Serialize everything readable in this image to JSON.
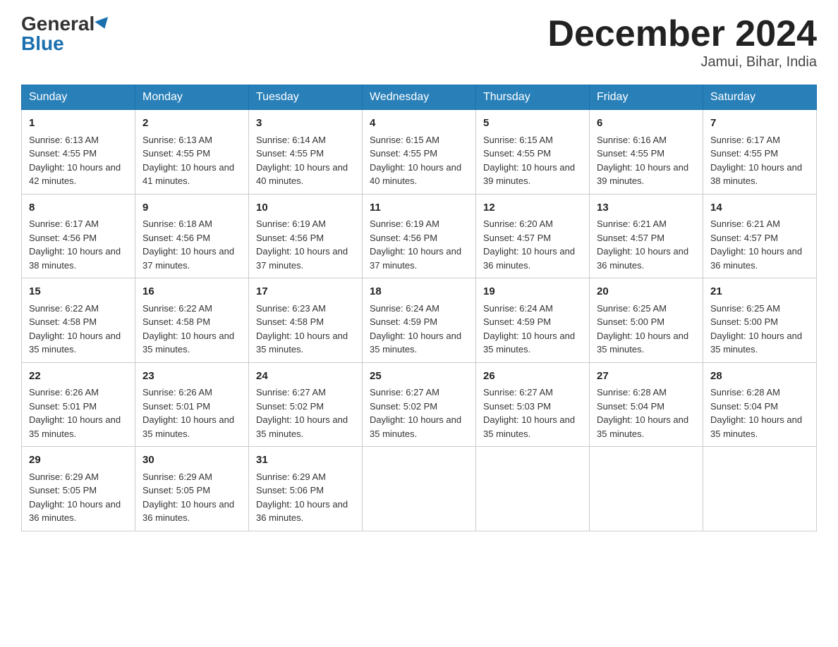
{
  "header": {
    "logo_general": "General",
    "logo_blue": "Blue",
    "month_title": "December 2024",
    "location": "Jamui, Bihar, India"
  },
  "days_of_week": [
    "Sunday",
    "Monday",
    "Tuesday",
    "Wednesday",
    "Thursday",
    "Friday",
    "Saturday"
  ],
  "weeks": [
    [
      {
        "day": "1",
        "sunrise": "6:13 AM",
        "sunset": "4:55 PM",
        "daylight": "10 hours and 42 minutes."
      },
      {
        "day": "2",
        "sunrise": "6:13 AM",
        "sunset": "4:55 PM",
        "daylight": "10 hours and 41 minutes."
      },
      {
        "day": "3",
        "sunrise": "6:14 AM",
        "sunset": "4:55 PM",
        "daylight": "10 hours and 40 minutes."
      },
      {
        "day": "4",
        "sunrise": "6:15 AM",
        "sunset": "4:55 PM",
        "daylight": "10 hours and 40 minutes."
      },
      {
        "day": "5",
        "sunrise": "6:15 AM",
        "sunset": "4:55 PM",
        "daylight": "10 hours and 39 minutes."
      },
      {
        "day": "6",
        "sunrise": "6:16 AM",
        "sunset": "4:55 PM",
        "daylight": "10 hours and 39 minutes."
      },
      {
        "day": "7",
        "sunrise": "6:17 AM",
        "sunset": "4:55 PM",
        "daylight": "10 hours and 38 minutes."
      }
    ],
    [
      {
        "day": "8",
        "sunrise": "6:17 AM",
        "sunset": "4:56 PM",
        "daylight": "10 hours and 38 minutes."
      },
      {
        "day": "9",
        "sunrise": "6:18 AM",
        "sunset": "4:56 PM",
        "daylight": "10 hours and 37 minutes."
      },
      {
        "day": "10",
        "sunrise": "6:19 AM",
        "sunset": "4:56 PM",
        "daylight": "10 hours and 37 minutes."
      },
      {
        "day": "11",
        "sunrise": "6:19 AM",
        "sunset": "4:56 PM",
        "daylight": "10 hours and 37 minutes."
      },
      {
        "day": "12",
        "sunrise": "6:20 AM",
        "sunset": "4:57 PM",
        "daylight": "10 hours and 36 minutes."
      },
      {
        "day": "13",
        "sunrise": "6:21 AM",
        "sunset": "4:57 PM",
        "daylight": "10 hours and 36 minutes."
      },
      {
        "day": "14",
        "sunrise": "6:21 AM",
        "sunset": "4:57 PM",
        "daylight": "10 hours and 36 minutes."
      }
    ],
    [
      {
        "day": "15",
        "sunrise": "6:22 AM",
        "sunset": "4:58 PM",
        "daylight": "10 hours and 35 minutes."
      },
      {
        "day": "16",
        "sunrise": "6:22 AM",
        "sunset": "4:58 PM",
        "daylight": "10 hours and 35 minutes."
      },
      {
        "day": "17",
        "sunrise": "6:23 AM",
        "sunset": "4:58 PM",
        "daylight": "10 hours and 35 minutes."
      },
      {
        "day": "18",
        "sunrise": "6:24 AM",
        "sunset": "4:59 PM",
        "daylight": "10 hours and 35 minutes."
      },
      {
        "day": "19",
        "sunrise": "6:24 AM",
        "sunset": "4:59 PM",
        "daylight": "10 hours and 35 minutes."
      },
      {
        "day": "20",
        "sunrise": "6:25 AM",
        "sunset": "5:00 PM",
        "daylight": "10 hours and 35 minutes."
      },
      {
        "day": "21",
        "sunrise": "6:25 AM",
        "sunset": "5:00 PM",
        "daylight": "10 hours and 35 minutes."
      }
    ],
    [
      {
        "day": "22",
        "sunrise": "6:26 AM",
        "sunset": "5:01 PM",
        "daylight": "10 hours and 35 minutes."
      },
      {
        "day": "23",
        "sunrise": "6:26 AM",
        "sunset": "5:01 PM",
        "daylight": "10 hours and 35 minutes."
      },
      {
        "day": "24",
        "sunrise": "6:27 AM",
        "sunset": "5:02 PM",
        "daylight": "10 hours and 35 minutes."
      },
      {
        "day": "25",
        "sunrise": "6:27 AM",
        "sunset": "5:02 PM",
        "daylight": "10 hours and 35 minutes."
      },
      {
        "day": "26",
        "sunrise": "6:27 AM",
        "sunset": "5:03 PM",
        "daylight": "10 hours and 35 minutes."
      },
      {
        "day": "27",
        "sunrise": "6:28 AM",
        "sunset": "5:04 PM",
        "daylight": "10 hours and 35 minutes."
      },
      {
        "day": "28",
        "sunrise": "6:28 AM",
        "sunset": "5:04 PM",
        "daylight": "10 hours and 35 minutes."
      }
    ],
    [
      {
        "day": "29",
        "sunrise": "6:29 AM",
        "sunset": "5:05 PM",
        "daylight": "10 hours and 36 minutes."
      },
      {
        "day": "30",
        "sunrise": "6:29 AM",
        "sunset": "5:05 PM",
        "daylight": "10 hours and 36 minutes."
      },
      {
        "day": "31",
        "sunrise": "6:29 AM",
        "sunset": "5:06 PM",
        "daylight": "10 hours and 36 minutes."
      },
      null,
      null,
      null,
      null
    ]
  ]
}
